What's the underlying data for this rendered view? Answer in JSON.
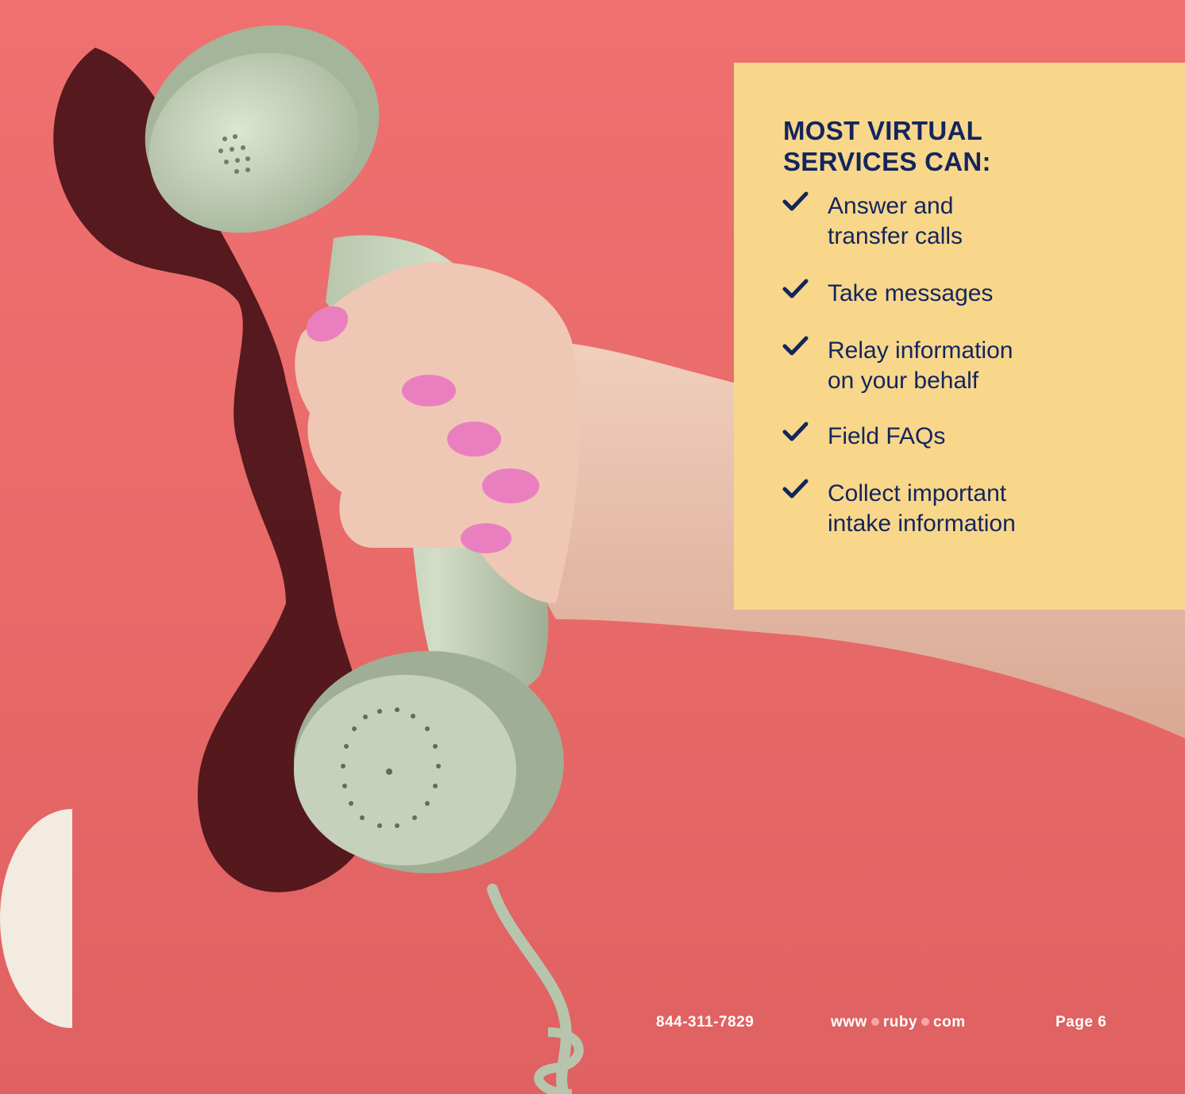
{
  "colors": {
    "background": "#ee6f6e",
    "panel": "#f8d78b",
    "navy": "#14255c",
    "cream": "#f3ebe0",
    "footer_text": "#ffffff"
  },
  "panel": {
    "heading_line1": "MOST VIRTUAL",
    "heading_line2": "SERVICES CAN:",
    "items": [
      {
        "line1": "Answer and",
        "line2": "transfer calls"
      },
      {
        "line1": "Take messages",
        "line2": ""
      },
      {
        "line1": "Relay information",
        "line2": "on your behalf"
      },
      {
        "line1": "Field FAQs",
        "line2": ""
      },
      {
        "line1": "Collect important",
        "line2": "intake information"
      }
    ],
    "icon": "checkmark-icon"
  },
  "footer": {
    "phone": "844-311-7829",
    "web_part1": "www",
    "web_part2": "ruby",
    "web_part3": "com",
    "page": "Page 6"
  },
  "photo": {
    "subject": "hand-holding-phone-handset"
  }
}
